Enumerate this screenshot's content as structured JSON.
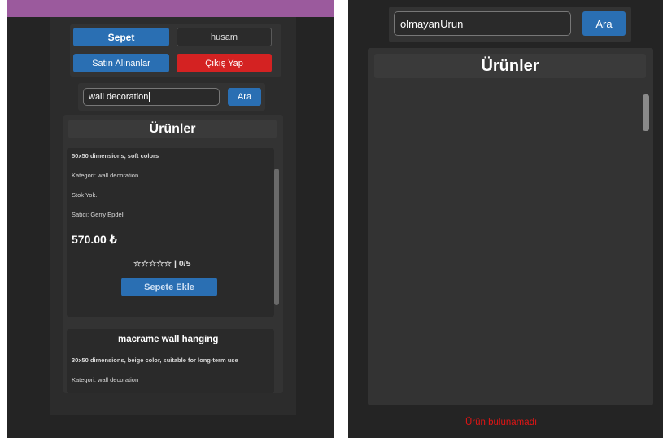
{
  "left": {
    "nav": {
      "cart_label": "Sepet",
      "user_label": "husam",
      "purchased_label": "Satın Alınanlar",
      "logout_label": "Çıkış Yap"
    },
    "search": {
      "value": "wall decoration",
      "button_label": "Ara"
    },
    "products": {
      "title": "Ürünler",
      "items": [
        {
          "description": "50x50 dimensions, soft colors",
          "category": "Kategori: wall decoration",
          "stock": "Stok Yok.",
          "seller": "Satıcı: Gerry Epdell",
          "price": "570.00 ₺",
          "rating": "☆☆☆☆☆ | 0/5",
          "add_label": "Sepete Ekle"
        },
        {
          "name": "macrame wall hanging",
          "description": "30x50 dimensions, beige color, suitable for long-term use",
          "category": "Kategori: wall decoration"
        }
      ]
    }
  },
  "right": {
    "search": {
      "value": "olmayanUrun",
      "button_label": "Ara"
    },
    "products": {
      "title": "Ürünler"
    },
    "status": "Ürün bulunamadı"
  },
  "colors": {
    "accent_blue": "#2a6fb3",
    "danger_red": "#d42222",
    "header_purple": "#9b5a9d",
    "error_text": "#e01515"
  }
}
